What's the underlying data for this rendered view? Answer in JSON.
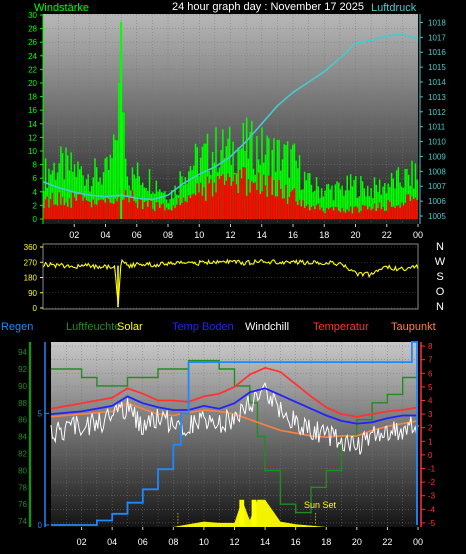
{
  "header": {
    "wind_label": "Windstärke",
    "title": "24 hour graph day : November 17 2025",
    "pressure_label": "Luftdruck"
  },
  "colors": {
    "wind": "#00ff00",
    "gust": "#ff0000",
    "pressure": "#44cccc",
    "direction": "#ffff00",
    "rain": "#1e88ff",
    "humidity": "#228b22",
    "solar": "#ffff00",
    "temp_ground": "#2222ff",
    "windchill": "#ffffff",
    "temperature": "#ff3333",
    "dewpoint": "#ff8040"
  },
  "legend": {
    "rain": "Regen",
    "humidity": "Luftfeuchte",
    "solar": "Solar",
    "temp_ground": "Temp Boden",
    "windchill": "Windchill",
    "temperature": "Temperatur",
    "dewpoint": "Taupunkt"
  },
  "direction_letters": [
    "N",
    "W",
    "S",
    "O",
    "N"
  ],
  "sunset_label": "Sun Set",
  "chart_data": [
    {
      "type": "line",
      "name": "wind_pressure",
      "x_ticks": [
        "02",
        "04",
        "06",
        "08",
        "10",
        "12",
        "14",
        "16",
        "18",
        "20",
        "22",
        "00"
      ],
      "y_left_ticks": [
        "0",
        "2",
        "4",
        "6",
        "8",
        "10",
        "12",
        "14",
        "16",
        "18",
        "20",
        "22",
        "24",
        "26",
        "28",
        "30"
      ],
      "y_left_range": [
        0,
        30
      ],
      "y_right_ticks": [
        "1005",
        "1006",
        "1007",
        "1008",
        "1009",
        "1010",
        "1011",
        "1012",
        "1013",
        "1014",
        "1015",
        "1016",
        "1017",
        "1018"
      ],
      "y_right_range": [
        1004.8,
        1018.5
      ],
      "x_range": [
        0,
        24
      ],
      "series": [
        {
          "name": "Windstärke",
          "axis": "left",
          "x": [
            0,
            1,
            2,
            3,
            4,
            4.5,
            5,
            5.5,
            6,
            7,
            8,
            8.5,
            9,
            10,
            11,
            12,
            13,
            14,
            15,
            16,
            17,
            18,
            19,
            20,
            21,
            22,
            23,
            24
          ],
          "values": [
            9,
            11,
            10,
            9,
            9,
            12,
            29,
            8,
            9,
            8,
            5,
            6,
            10,
            12,
            14,
            14,
            15,
            14,
            13,
            12,
            7,
            6,
            6,
            7,
            6,
            7,
            8,
            9
          ]
        },
        {
          "name": "Böen",
          "axis": "left",
          "x": [
            0,
            2,
            4,
            5,
            6,
            8,
            10,
            12,
            13,
            14,
            15,
            16,
            17,
            18,
            20,
            22,
            24
          ],
          "values": [
            4,
            4,
            3,
            5,
            4,
            2,
            6,
            7,
            8,
            7,
            6,
            5,
            3,
            2,
            2,
            3,
            4
          ]
        },
        {
          "name": "Luftdruck",
          "axis": "right",
          "x": [
            0,
            1,
            2,
            3,
            4,
            5,
            6,
            7,
            8,
            9,
            10,
            11,
            12,
            13,
            14,
            15,
            16,
            17,
            18,
            19,
            20,
            21,
            22,
            23,
            24
          ],
          "values": [
            1007.3,
            1006.9,
            1006.6,
            1006.4,
            1006.3,
            1006.4,
            1006.2,
            1006.1,
            1006.4,
            1007.2,
            1007.8,
            1008.3,
            1009.0,
            1010.0,
            1011.2,
            1012.4,
            1013.3,
            1014.0,
            1014.7,
            1015.6,
            1016.6,
            1016.8,
            1017.1,
            1017.2,
            1016.9
          ]
        }
      ]
    },
    {
      "type": "line",
      "name": "wind_direction",
      "x_range": [
        0,
        24
      ],
      "y_ticks": [
        "0",
        "90",
        "180",
        "270",
        "360"
      ],
      "y_range": [
        0,
        360
      ],
      "series": [
        {
          "name": "Windrichtung",
          "x": [
            0,
            1,
            2,
            3,
            4,
            4.6,
            4.8,
            5,
            5.5,
            6,
            7,
            8,
            9,
            10,
            11,
            12,
            13,
            14,
            15,
            16,
            17,
            18,
            19,
            20,
            21,
            22,
            23,
            24
          ],
          "values": [
            255,
            250,
            245,
            250,
            240,
            250,
            5,
            275,
            245,
            260,
            255,
            260,
            270,
            265,
            275,
            270,
            265,
            275,
            270,
            272,
            268,
            270,
            262,
            205,
            195,
            240,
            230,
            240
          ]
        }
      ]
    },
    {
      "type": "line",
      "name": "temperature_humidity",
      "x_ticks": [
        "02",
        "04",
        "06",
        "08",
        "10",
        "12",
        "14",
        "16",
        "18",
        "20",
        "22",
        "00"
      ],
      "x_range": [
        0,
        24
      ],
      "y_humidity_ticks": [
        "74",
        "76",
        "78",
        "80",
        "82",
        "84",
        "86",
        "88",
        "90",
        "92",
        "94"
      ],
      "y_humidity_range": [
        73.3,
        95.2
      ],
      "y_rain_ticks": [
        "0",
        "5"
      ],
      "y_rain_range": [
        0,
        8.2
      ],
      "y_temp_ticks": [
        "8",
        "7",
        "6",
        "5",
        "4",
        "3",
        "2",
        "1",
        "0",
        "-1",
        "-2",
        "-3",
        "-4",
        "-5"
      ],
      "y_temp_range": [
        -5.3,
        8.3
      ],
      "sunset_hour": 17.3,
      "series": [
        {
          "name": "Regen",
          "axis": "rain",
          "x": [
            0,
            2,
            3,
            4,
            5,
            6,
            7,
            8,
            8.5,
            9,
            10,
            12,
            14,
            16,
            18,
            20,
            22,
            23.6,
            24
          ],
          "values": [
            0,
            0,
            0.2,
            0.5,
            1.0,
            1.6,
            2.5,
            3.6,
            5.0,
            7.3,
            7.3,
            7.3,
            7.3,
            7.3,
            7.3,
            7.3,
            7.3,
            8.2,
            8.2
          ]
        },
        {
          "name": "Luftfeuchte",
          "axis": "humidity",
          "x": [
            0,
            1,
            2,
            3,
            5,
            7,
            8.5,
            9,
            10,
            11,
            12,
            13,
            13.5,
            14,
            15,
            16,
            17,
            18,
            19,
            20,
            21,
            22,
            23,
            24
          ],
          "values": [
            92,
            92,
            91,
            90,
            91,
            92,
            92,
            93,
            93,
            92,
            90,
            88,
            84,
            80,
            76,
            75,
            78,
            80,
            84,
            86,
            88,
            89,
            91,
            91
          ]
        },
        {
          "name": "Solar",
          "axis": "temp",
          "x": [
            0,
            8,
            9,
            10,
            11,
            12,
            12.5,
            13,
            13.5,
            14,
            15,
            16,
            17,
            18,
            24
          ],
          "values": [
            -5.3,
            -5.3,
            -5.1,
            -4.9,
            -5.0,
            -5.0,
            -3.3,
            -4.8,
            -3.3,
            -3.3,
            -4.9,
            -5.1,
            -5.2,
            -5.3,
            -5.3
          ]
        },
        {
          "name": "Temp Boden",
          "axis": "temp",
          "x": [
            0,
            2,
            4,
            5,
            6,
            7,
            8,
            9,
            10,
            11,
            12,
            13,
            14,
            15,
            16,
            17,
            18,
            19,
            20,
            21,
            22,
            23,
            24
          ],
          "values": [
            3.0,
            3.2,
            3.6,
            4.3,
            3.8,
            3.5,
            3.3,
            3.3,
            3.6,
            3.4,
            3.8,
            4.6,
            4.9,
            4.4,
            3.9,
            3.4,
            2.9,
            2.5,
            2.3,
            2.4,
            2.7,
            2.9,
            2.9
          ]
        },
        {
          "name": "Windchill",
          "axis": "temp",
          "x": [
            0,
            1,
            2,
            3,
            4,
            5,
            6,
            7,
            8,
            9,
            10,
            11,
            12,
            13,
            14,
            15,
            16,
            17,
            18,
            19,
            20,
            21,
            22,
            23,
            24
          ],
          "values": [
            2.2,
            2.8,
            3.0,
            3.1,
            3.6,
            4.2,
            3.0,
            3.4,
            3.2,
            2.9,
            3.3,
            3.1,
            3.6,
            4.5,
            5.6,
            4.0,
            3.3,
            2.7,
            2.3,
            1.8,
            1.4,
            2.1,
            2.4,
            2.7,
            2.9
          ]
        },
        {
          "name": "Temperatur",
          "axis": "temp",
          "x": [
            0,
            2,
            4,
            5,
            6,
            7,
            8,
            9,
            10,
            11,
            12,
            13,
            14,
            15,
            16,
            17,
            18,
            19,
            20,
            21,
            22,
            23,
            24
          ],
          "values": [
            3.4,
            3.8,
            4.2,
            4.9,
            4.5,
            4.0,
            4.0,
            3.9,
            4.3,
            4.5,
            5.0,
            5.9,
            6.4,
            6.1,
            5.2,
            4.3,
            3.5,
            3.0,
            2.8,
            3.0,
            3.2,
            3.3,
            3.5
          ]
        },
        {
          "name": "Taupunkt",
          "axis": "temp",
          "x": [
            0,
            2,
            4,
            5,
            6,
            7,
            8,
            9,
            10,
            11,
            12,
            13,
            14,
            15,
            16,
            17,
            18,
            19,
            20,
            21,
            22,
            23,
            24
          ],
          "values": [
            2.8,
            3.0,
            3.2,
            3.8,
            3.4,
            3.0,
            2.9,
            3.1,
            3.3,
            3.2,
            3.0,
            2.6,
            2.2,
            1.8,
            1.6,
            1.4,
            1.3,
            1.4,
            1.4,
            1.8,
            2.1,
            2.3,
            2.5
          ]
        }
      ]
    }
  ]
}
